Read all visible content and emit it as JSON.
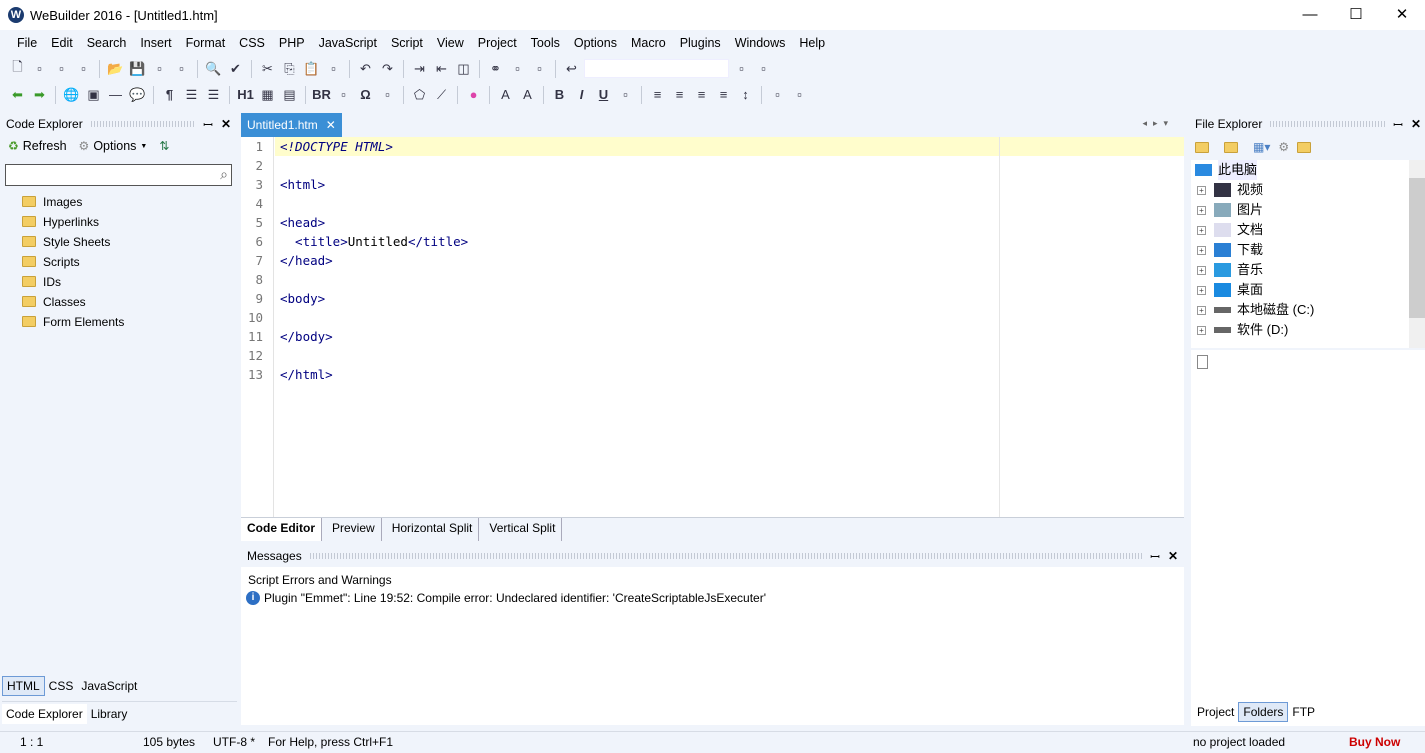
{
  "window": {
    "title": "WeBuilder 2016 - [Untitled1.htm]",
    "logo": "W",
    "minimize": "—",
    "maximize": "☐",
    "close": "✕"
  },
  "menu": [
    "File",
    "Edit",
    "Search",
    "Insert",
    "Format",
    "CSS",
    "PHP",
    "JavaScript",
    "Script",
    "View",
    "Project",
    "Tools",
    "Options",
    "Macro",
    "Plugins",
    "Windows",
    "Help"
  ],
  "toolbar1": [
    "new-file-icon",
    "open-html-icon",
    "edit-icon",
    "php-file-icon",
    "open-folder-icon",
    "save-icon",
    "save-all-icon",
    "publish-icon",
    "find-icon",
    "spellcheck-icon",
    "cut-icon",
    "copy-icon",
    "paste-icon",
    "paste-special-icon",
    "undo-icon",
    "redo-icon",
    "indent-icon",
    "outdent-icon",
    "layout-icon",
    "binoculars-icon",
    "replace-icon",
    "folder-search-icon",
    "jump-icon",
    "bookmark-prev-icon",
    "bookmark-next-icon"
  ],
  "toolbar2": [
    "back-arrow-icon",
    "forward-arrow-icon",
    "link-icon",
    "image-icon",
    "hr-icon",
    "comment-icon",
    "paragraph-icon",
    "bullet-list-icon",
    "numbered-list-icon",
    "heading-icon",
    "table-icon",
    "form-icon",
    "br-icon",
    "anchor-icon",
    "omega-icon",
    "script-icon",
    "tag-icon",
    "brush-icon",
    "color-icon",
    "font-icon",
    "font-size-icon",
    "bold-icon",
    "italic-icon",
    "underline-icon",
    "strike-icon",
    "align-left-icon",
    "align-center-icon",
    "align-right-icon",
    "justify-icon",
    "line-spacing-icon",
    "wrap-icon",
    "fill-icon"
  ],
  "toolbar2_labels": {
    "br": "BR",
    "bold": "B",
    "italic": "I",
    "underline": "U",
    "heading": "H1",
    "omega": "Ω",
    "paragraph": "¶"
  },
  "code_explorer": {
    "title": "Code Explorer",
    "refresh": "Refresh",
    "options": "Options",
    "search_placeholder": "",
    "items": [
      "Images",
      "Hyperlinks",
      "Style Sheets",
      "Scripts",
      "IDs",
      "Classes",
      "Form Elements"
    ],
    "lang_tabs": [
      "HTML",
      "CSS",
      "JavaScript"
    ],
    "bottom_tabs": [
      "Code Explorer",
      "Library"
    ]
  },
  "editor": {
    "tab": "Untitled1.htm",
    "lines": [
      "<!DOCTYPE HTML>",
      "",
      "<html>",
      "",
      "<head>",
      "  <title>Untitled</title>",
      "</head>",
      "",
      "<body>",
      "",
      "</body>",
      "",
      "</html>"
    ],
    "view_tabs": [
      "Code Editor",
      "Preview",
      "Horizontal Split",
      "Vertical Split"
    ]
  },
  "messages": {
    "title": "Messages",
    "heading": "Script Errors and Warnings",
    "entries": [
      "Plugin \"Emmet\": Line 19:52:  Compile error: Undeclared identifier: 'CreateScriptableJsExecuter'"
    ]
  },
  "file_explorer": {
    "title": "File Explorer",
    "root": "此电脑",
    "items": [
      {
        "label": "视频",
        "icon": "video-icon"
      },
      {
        "label": "图片",
        "icon": "pictures-icon"
      },
      {
        "label": "文档",
        "icon": "documents-icon"
      },
      {
        "label": "下载",
        "icon": "download-icon"
      },
      {
        "label": "音乐",
        "icon": "music-icon"
      },
      {
        "label": "桌面",
        "icon": "desktop-icon"
      },
      {
        "label": "本地磁盘 (C:)",
        "icon": "drive-icon"
      },
      {
        "label": "软件 (D:)",
        "icon": "drive-icon"
      }
    ],
    "bottom_tabs": [
      "Project",
      "Folders",
      "FTP"
    ]
  },
  "status": {
    "position": "1 : 1",
    "size": "105 bytes",
    "encoding": "UTF-8 *",
    "help": "For Help, press Ctrl+F1",
    "project": "no project loaded",
    "buy": "Buy Now"
  },
  "colors": {
    "accent": "#3b8fd6",
    "buy": "#cc0000",
    "current_line": "#fffdcc",
    "tag": "#000080"
  }
}
